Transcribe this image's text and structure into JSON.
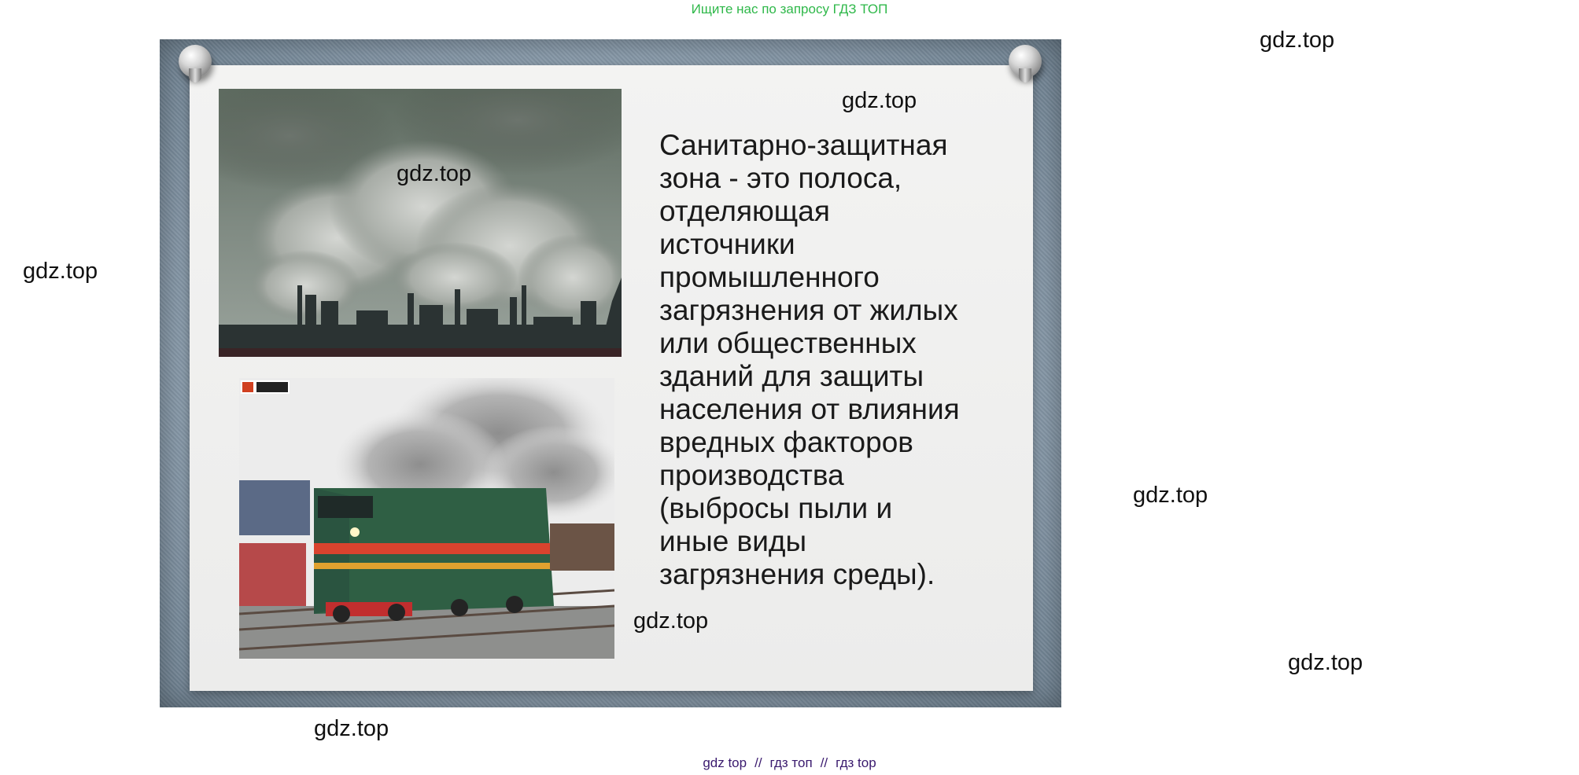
{
  "top_banner": "Ищите нас по запросу ГДЗ ТОП",
  "watermark": "gdz.top",
  "slide": {
    "text": "Санитарно-защитная\nзона - это полоса,\nотделяющая\nисточники\nпромышленного\nзагрязнения от жилых\nили общественных\nзданий для защиты\nнаселения от влияния\nвредных факторов\nпроизводства\n(выбросы пыли и\nиные виды\nзагрязнения среды)."
  },
  "bottom_links": [
    "gdz top",
    "гдз топ",
    "гдз top"
  ],
  "bottom_separator": "//",
  "colors": {
    "banner": "#2fb84a",
    "links": "#3a1a6e",
    "slide_background": "#8fa1b1",
    "paper": "#f0f0ef"
  }
}
